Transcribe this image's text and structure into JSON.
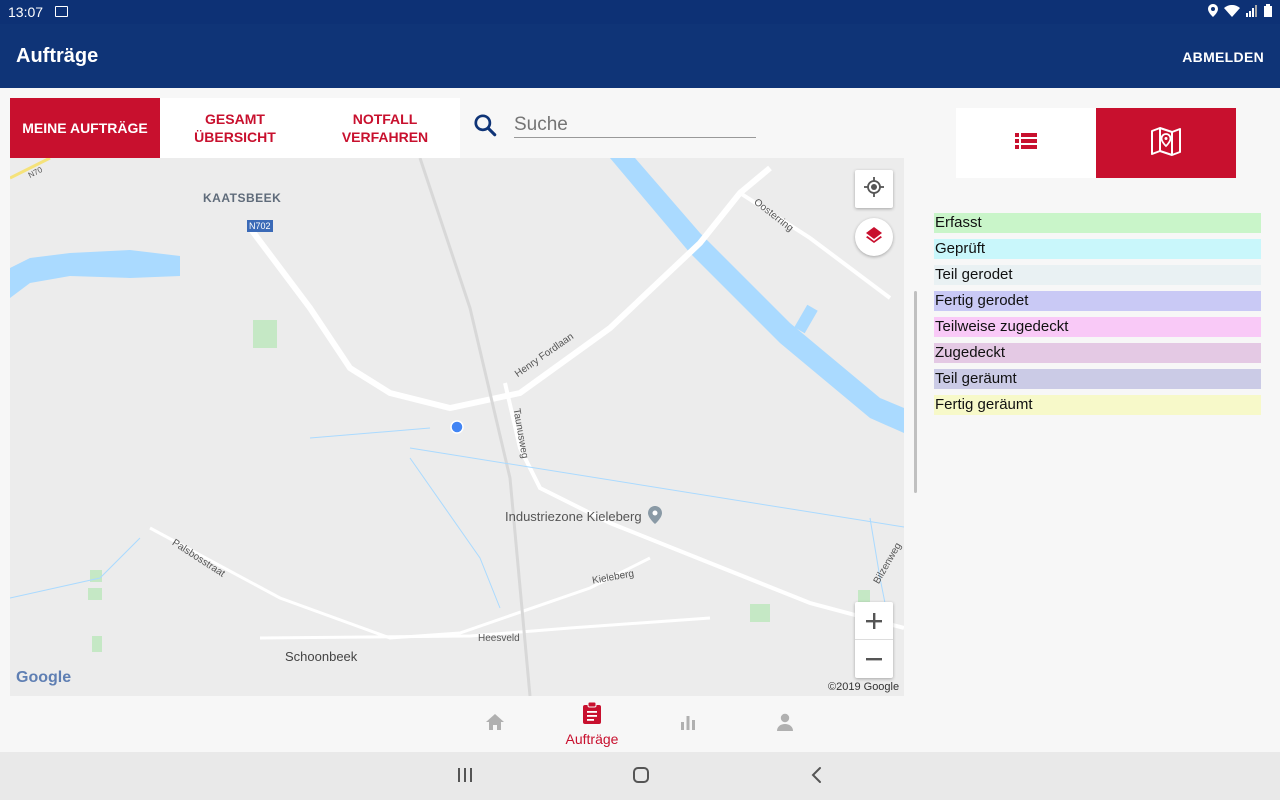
{
  "status_bar": {
    "time": "13:07",
    "icons": [
      "image-icon",
      "location-icon",
      "wifi-icon",
      "signal-icon",
      "battery-icon"
    ]
  },
  "app_bar": {
    "title": "Aufträge",
    "logout_label": "ABMELDEN"
  },
  "tabs": [
    {
      "label": "MEINE AUFTRÄGE",
      "active": true
    },
    {
      "label": "GESAMT\nÜBERSICHT",
      "active": false
    },
    {
      "label": "NOTFALL\nVERFAHREN",
      "active": false
    }
  ],
  "search": {
    "placeholder": "Suche",
    "value": ""
  },
  "map": {
    "place_labels": {
      "kaatsbeek": "KAATSBEEK",
      "n702": "N702",
      "n70": "N70",
      "oosterring": "Oosterring",
      "henry_fordlaan": "Henry Fordlaan",
      "taunusweg": "Taunusweg",
      "industriezone": "Industriezone Kieleberg",
      "palsbosstraat": "Palsbosstraat",
      "kieleberg": "Kieleberg",
      "bilzenweg": "Bilzenweg",
      "heesveld": "Heesveld",
      "schoonbeek": "Schoonbeek"
    },
    "attribution": "©2019 Google",
    "logo": "Google"
  },
  "legend": [
    {
      "label": "Erfasst",
      "color": "#c9f5c9"
    },
    {
      "label": "Geprüft",
      "color": "#c9f7fb"
    },
    {
      "label": "Teil gerodet",
      "color": "#e9f1f3"
    },
    {
      "label": "Fertig gerodet",
      "color": "#c9c9f5"
    },
    {
      "label": "Teilweise zugedeckt",
      "color": "#f9c9f7"
    },
    {
      "label": "Zugedeckt",
      "color": "#e4c9e4"
    },
    {
      "label": "Teil geräumt",
      "color": "#cbcbe6"
    },
    {
      "label": "Fertig geräumt",
      "color": "#f7f9c9"
    }
  ],
  "bottom_nav": {
    "active_label": "Aufträge"
  },
  "colors": {
    "primary": "#0f3477",
    "accent": "#c8102e"
  }
}
